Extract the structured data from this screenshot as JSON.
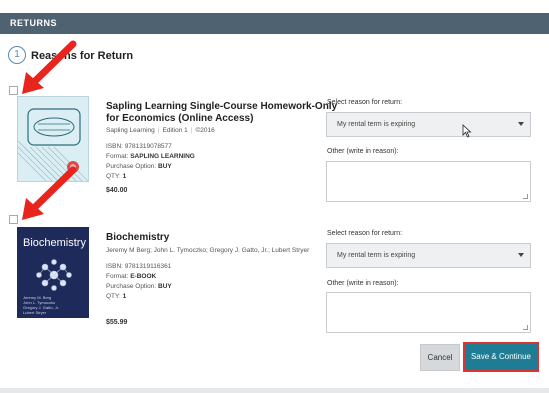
{
  "section": {
    "title": "RETURNS"
  },
  "step": {
    "number": "1",
    "title": "Reasons for Return"
  },
  "items": [
    {
      "title_line1": "Sapling Learning Single-Course Homework-Only",
      "title_line2": "for Economics (Online Access)",
      "publisher": "Sapling Learning",
      "edition": "Edition 1",
      "year": "©2016",
      "isbn": "ISBN: 9781319078577",
      "format_label": "Format:",
      "format_value": "SAPLING LEARNING",
      "purchase_label": "Purchase Option:",
      "purchase_value": "BUY",
      "qty_label": "QTY:",
      "qty_value": "1",
      "price": "$40.00",
      "reason_label": "Select reason for return:",
      "reason_value": "My rental term is expiring",
      "other_label": "Other (write in reason):"
    },
    {
      "title_line1": "Biochemistry",
      "authors": "Jeremy M Berg; John L. Tymoczko; Gregory J. Gatto, Jr.; Lubert Stryer",
      "isbn": "ISBN: 9781319116361",
      "format_label": "Format:",
      "format_value": "E-BOOK",
      "purchase_label": "Purchase Option:",
      "purchase_value": "BUY",
      "qty_label": "QTY:",
      "qty_value": "1",
      "price": "$55.99",
      "reason_label": "Select reason for return:",
      "reason_value": "My rental term is expiring",
      "other_label": "Other (write in reason):",
      "cover_title": "Biochemistry",
      "cover_authors": "Jeremy M. Berg\nJohn L. Tymoczko\nGregory J. Gatto, Jr.\nLubert Stryer"
    }
  ],
  "buttons": {
    "cancel": "Cancel",
    "save": "Save & Continue"
  },
  "colors": {
    "header_bar": "#4f6272",
    "primary_button": "#1f7c95",
    "highlight_border": "#e03030",
    "arrow": "#e8241c"
  }
}
